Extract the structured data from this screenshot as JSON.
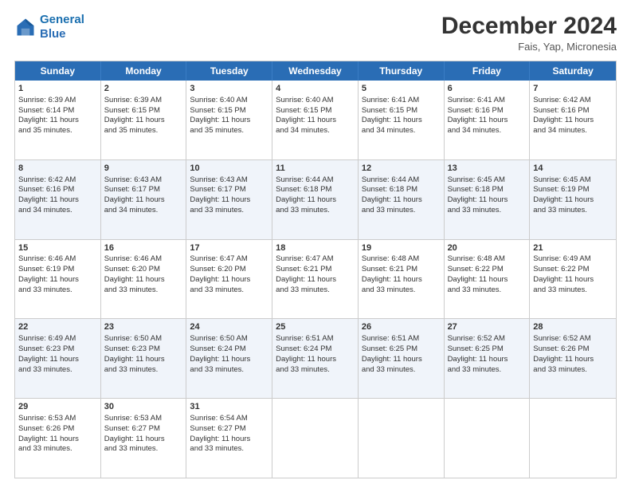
{
  "header": {
    "logo_line1": "General",
    "logo_line2": "Blue",
    "month": "December 2024",
    "location": "Fais, Yap, Micronesia"
  },
  "days": [
    "Sunday",
    "Monday",
    "Tuesday",
    "Wednesday",
    "Thursday",
    "Friday",
    "Saturday"
  ],
  "rows": [
    [
      {
        "day": "1",
        "info": "Sunrise: 6:39 AM\nSunset: 6:14 PM\nDaylight: 11 hours\nand 35 minutes."
      },
      {
        "day": "2",
        "info": "Sunrise: 6:39 AM\nSunset: 6:15 PM\nDaylight: 11 hours\nand 35 minutes."
      },
      {
        "day": "3",
        "info": "Sunrise: 6:40 AM\nSunset: 6:15 PM\nDaylight: 11 hours\nand 35 minutes."
      },
      {
        "day": "4",
        "info": "Sunrise: 6:40 AM\nSunset: 6:15 PM\nDaylight: 11 hours\nand 34 minutes."
      },
      {
        "day": "5",
        "info": "Sunrise: 6:41 AM\nSunset: 6:15 PM\nDaylight: 11 hours\nand 34 minutes."
      },
      {
        "day": "6",
        "info": "Sunrise: 6:41 AM\nSunset: 6:16 PM\nDaylight: 11 hours\nand 34 minutes."
      },
      {
        "day": "7",
        "info": "Sunrise: 6:42 AM\nSunset: 6:16 PM\nDaylight: 11 hours\nand 34 minutes."
      }
    ],
    [
      {
        "day": "8",
        "info": "Sunrise: 6:42 AM\nSunset: 6:16 PM\nDaylight: 11 hours\nand 34 minutes."
      },
      {
        "day": "9",
        "info": "Sunrise: 6:43 AM\nSunset: 6:17 PM\nDaylight: 11 hours\nand 34 minutes."
      },
      {
        "day": "10",
        "info": "Sunrise: 6:43 AM\nSunset: 6:17 PM\nDaylight: 11 hours\nand 33 minutes."
      },
      {
        "day": "11",
        "info": "Sunrise: 6:44 AM\nSunset: 6:18 PM\nDaylight: 11 hours\nand 33 minutes."
      },
      {
        "day": "12",
        "info": "Sunrise: 6:44 AM\nSunset: 6:18 PM\nDaylight: 11 hours\nand 33 minutes."
      },
      {
        "day": "13",
        "info": "Sunrise: 6:45 AM\nSunset: 6:18 PM\nDaylight: 11 hours\nand 33 minutes."
      },
      {
        "day": "14",
        "info": "Sunrise: 6:45 AM\nSunset: 6:19 PM\nDaylight: 11 hours\nand 33 minutes."
      }
    ],
    [
      {
        "day": "15",
        "info": "Sunrise: 6:46 AM\nSunset: 6:19 PM\nDaylight: 11 hours\nand 33 minutes."
      },
      {
        "day": "16",
        "info": "Sunrise: 6:46 AM\nSunset: 6:20 PM\nDaylight: 11 hours\nand 33 minutes."
      },
      {
        "day": "17",
        "info": "Sunrise: 6:47 AM\nSunset: 6:20 PM\nDaylight: 11 hours\nand 33 minutes."
      },
      {
        "day": "18",
        "info": "Sunrise: 6:47 AM\nSunset: 6:21 PM\nDaylight: 11 hours\nand 33 minutes."
      },
      {
        "day": "19",
        "info": "Sunrise: 6:48 AM\nSunset: 6:21 PM\nDaylight: 11 hours\nand 33 minutes."
      },
      {
        "day": "20",
        "info": "Sunrise: 6:48 AM\nSunset: 6:22 PM\nDaylight: 11 hours\nand 33 minutes."
      },
      {
        "day": "21",
        "info": "Sunrise: 6:49 AM\nSunset: 6:22 PM\nDaylight: 11 hours\nand 33 minutes."
      }
    ],
    [
      {
        "day": "22",
        "info": "Sunrise: 6:49 AM\nSunset: 6:23 PM\nDaylight: 11 hours\nand 33 minutes."
      },
      {
        "day": "23",
        "info": "Sunrise: 6:50 AM\nSunset: 6:23 PM\nDaylight: 11 hours\nand 33 minutes."
      },
      {
        "day": "24",
        "info": "Sunrise: 6:50 AM\nSunset: 6:24 PM\nDaylight: 11 hours\nand 33 minutes."
      },
      {
        "day": "25",
        "info": "Sunrise: 6:51 AM\nSunset: 6:24 PM\nDaylight: 11 hours\nand 33 minutes."
      },
      {
        "day": "26",
        "info": "Sunrise: 6:51 AM\nSunset: 6:25 PM\nDaylight: 11 hours\nand 33 minutes."
      },
      {
        "day": "27",
        "info": "Sunrise: 6:52 AM\nSunset: 6:25 PM\nDaylight: 11 hours\nand 33 minutes."
      },
      {
        "day": "28",
        "info": "Sunrise: 6:52 AM\nSunset: 6:26 PM\nDaylight: 11 hours\nand 33 minutes."
      }
    ],
    [
      {
        "day": "29",
        "info": "Sunrise: 6:53 AM\nSunset: 6:26 PM\nDaylight: 11 hours\nand 33 minutes."
      },
      {
        "day": "30",
        "info": "Sunrise: 6:53 AM\nSunset: 6:27 PM\nDaylight: 11 hours\nand 33 minutes."
      },
      {
        "day": "31",
        "info": "Sunrise: 6:54 AM\nSunset: 6:27 PM\nDaylight: 11 hours\nand 33 minutes."
      },
      {
        "day": "",
        "info": ""
      },
      {
        "day": "",
        "info": ""
      },
      {
        "day": "",
        "info": ""
      },
      {
        "day": "",
        "info": ""
      }
    ]
  ]
}
